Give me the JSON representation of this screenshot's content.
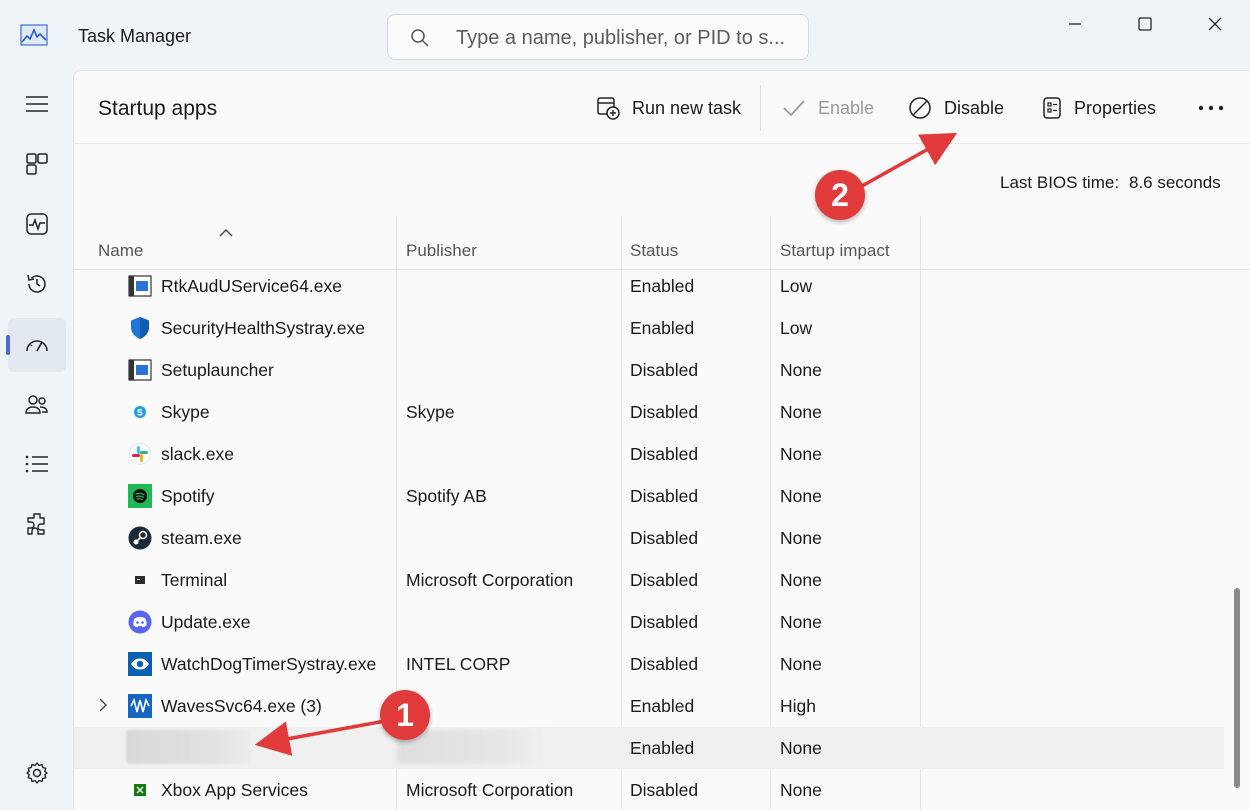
{
  "window": {
    "title": "Task Manager",
    "search_placeholder": "Type a name, publisher, or PID to s..."
  },
  "nav": {
    "items": [
      {
        "icon": "hamburger-icon"
      },
      {
        "icon": "processes-icon"
      },
      {
        "icon": "performance-icon"
      },
      {
        "icon": "app-history-icon"
      },
      {
        "icon": "startup-apps-icon",
        "active": true
      },
      {
        "icon": "users-icon"
      },
      {
        "icon": "details-icon"
      },
      {
        "icon": "services-icon"
      },
      {
        "icon": "settings-icon"
      }
    ]
  },
  "page": {
    "title": "Startup apps",
    "toolbar": {
      "run_new_task": "Run new task",
      "enable": "Enable",
      "disable": "Disable",
      "properties": "Properties"
    },
    "bios_label": "Last BIOS time:",
    "bios_value": "8.6 seconds"
  },
  "table": {
    "columns": [
      "Name",
      "Publisher",
      "Status",
      "Startup impact"
    ],
    "rows": [
      {
        "name": "RtkAudUService64.exe",
        "publisher": "",
        "status": "Enabled",
        "impact": "Low",
        "icon": "window-app-icon"
      },
      {
        "name": "SecurityHealthSystray.exe",
        "publisher": "",
        "status": "Enabled",
        "impact": "Low",
        "icon": "shield-icon"
      },
      {
        "name": "Setuplauncher",
        "publisher": "",
        "status": "Disabled",
        "impact": "None",
        "icon": "window-app-icon"
      },
      {
        "name": "Skype",
        "publisher": "Skype",
        "status": "Disabled",
        "impact": "None",
        "icon": "skype-icon"
      },
      {
        "name": "slack.exe",
        "publisher": "",
        "status": "Disabled",
        "impact": "None",
        "icon": "slack-icon"
      },
      {
        "name": "Spotify",
        "publisher": "Spotify AB",
        "status": "Disabled",
        "impact": "None",
        "icon": "spotify-icon"
      },
      {
        "name": "steam.exe",
        "publisher": "",
        "status": "Disabled",
        "impact": "None",
        "icon": "steam-icon"
      },
      {
        "name": "Terminal",
        "publisher": "Microsoft Corporation",
        "status": "Disabled",
        "impact": "None",
        "icon": "terminal-icon"
      },
      {
        "name": "Update.exe",
        "publisher": "",
        "status": "Disabled",
        "impact": "None",
        "icon": "discord-icon"
      },
      {
        "name": "WatchDogTimerSystray.exe",
        "publisher": "INTEL CORP",
        "status": "Disabled",
        "impact": "None",
        "icon": "eye-icon"
      },
      {
        "name": "WavesSvc64.exe (3)",
        "publisher": "",
        "status": "Enabled",
        "impact": "High",
        "icon": "waves-icon",
        "expandable": true
      },
      {
        "name": "",
        "publisher": "",
        "status": "Enabled",
        "impact": "None",
        "icon": "",
        "redacted": true,
        "selected": true
      },
      {
        "name": "Xbox App Services",
        "publisher": "Microsoft Corporation",
        "status": "Disabled",
        "impact": "None",
        "icon": "xbox-icon"
      }
    ]
  },
  "annotations": {
    "step1": "1",
    "step2": "2",
    "arrow_color": "#e03a3a"
  },
  "colors": {
    "accent": "#4f6bd1",
    "annotation": "#e03a3a"
  }
}
